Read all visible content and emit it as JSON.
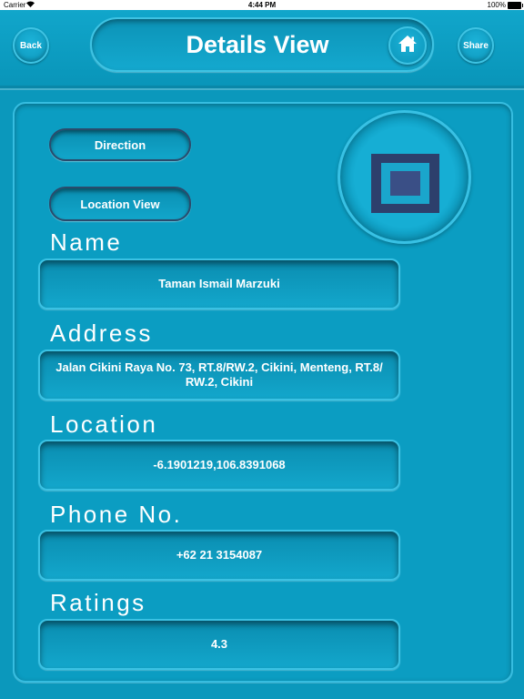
{
  "status_bar": {
    "carrier": "Carrier",
    "time": "4:44 PM",
    "battery": "100%"
  },
  "header": {
    "back_label": "Back",
    "title": "Details View",
    "share_label": "Share",
    "home_icon": "home-icon"
  },
  "actions": {
    "direction_label": "Direction",
    "location_view_label": "Location View"
  },
  "logo_icon": "square-logo-icon",
  "details": {
    "name_label": "Name",
    "name_value": "Taman Ismail Marzuki",
    "address_label": "Address",
    "address_value": "Jalan Cikini Raya No. 73, RT.8/RW.2, Cikini, Menteng, RT.8/ RW.2, Cikini",
    "location_label": "Location",
    "location_value": "-6.1901219,106.8391068",
    "phone_label": "Phone No.",
    "phone_value": "+62 21 3154087",
    "ratings_label": "Ratings",
    "ratings_value": "4.3"
  },
  "colors": {
    "background": "#0b98bc",
    "border_light": "#3ec3e3",
    "button_border_dark": "#2a4b6c",
    "logo_outer": "#2d3f6c",
    "logo_inner": "#3a4f86"
  }
}
